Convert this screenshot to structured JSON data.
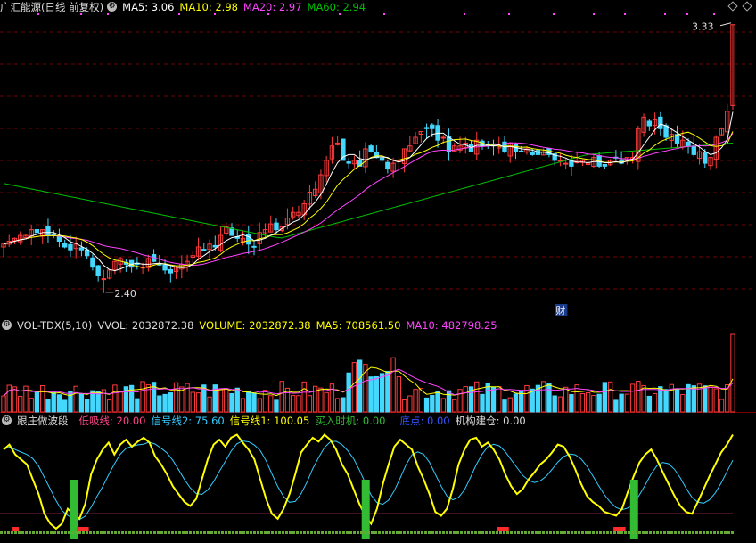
{
  "main_header": {
    "title": "广汇能源(日线 前复权)",
    "ma5": "MA5: 3.06",
    "ma10": "MA10: 2.98",
    "ma20": "MA20: 2.97",
    "ma60": "MA60: 2.94"
  },
  "vol_header": {
    "title": "VOL-TDX(5,10)",
    "vvol": "VVOL: 2032872.38",
    "volume": "VOLUME: 2032872.38",
    "ma5": "MA5: 708561.50",
    "ma10": "MA10: 482798.25"
  },
  "ind_header": {
    "title": "跟庄做波段",
    "low": "低吸线: 20.00",
    "sig2": "信号线2: 75.60",
    "sig1": "信号线1: 100.05",
    "buy": "买入时机: 0.00",
    "bottom": "底点: 0.00",
    "inst": "机构建仓: 0.00"
  },
  "annotations": {
    "high": "3.33",
    "low": "2.40",
    "fin_badge": "财"
  },
  "colors": {
    "up": "#ff3b3b",
    "down": "#44d8ff",
    "ma5": "#ffffff",
    "ma10": "#ffff00",
    "ma20": "#ff44ff",
    "ma60": "#00c000",
    "sig1": "#ffff00",
    "sig2": "#33ccff",
    "low_line": "#ff4488",
    "bar_green": "#33bb33",
    "grid": "#7a0000"
  },
  "chart_data": [
    {
      "type": "candlestick",
      "title": "广汇能源(日线 前复权)",
      "price_range": [
        2.35,
        3.36
      ],
      "series_names": [
        "MA5",
        "MA10",
        "MA20",
        "MA60"
      ],
      "close": [
        2.57,
        2.58,
        2.59,
        2.6,
        2.6,
        2.62,
        2.61,
        2.62,
        2.6,
        2.6,
        2.58,
        2.56,
        2.55,
        2.57,
        2.55,
        2.53,
        2.49,
        2.46,
        2.45,
        2.48,
        2.51,
        2.52,
        2.5,
        2.49,
        2.5,
        2.49,
        2.52,
        2.51,
        2.5,
        2.48,
        2.47,
        2.49,
        2.5,
        2.51,
        2.53,
        2.56,
        2.55,
        2.57,
        2.56,
        2.6,
        2.63,
        2.6,
        2.59,
        2.59,
        2.57,
        2.56,
        2.61,
        2.62,
        2.64,
        2.62,
        2.63,
        2.66,
        2.68,
        2.68,
        2.71,
        2.75,
        2.76,
        2.81,
        2.86,
        2.91,
        2.92,
        2.86,
        2.85,
        2.86,
        2.84,
        2.9,
        2.89,
        2.87,
        2.86,
        2.83,
        2.85,
        2.86,
        2.9,
        2.91,
        2.94,
        2.96,
        2.97,
        2.97,
        2.93,
        2.94,
        2.89,
        2.91,
        2.91,
        2.92,
        2.89,
        2.93,
        2.91,
        2.91,
        2.91,
        2.91,
        2.89,
        2.92,
        2.89,
        2.89,
        2.9,
        2.88,
        2.88,
        2.89,
        2.88,
        2.86,
        2.86,
        2.85,
        2.84,
        2.86,
        2.86,
        2.85,
        2.87,
        2.84,
        2.84,
        2.86,
        2.87,
        2.85,
        2.87,
        2.87,
        2.97,
        3.01,
        2.98,
        3.0,
        2.97,
        2.94,
        2.95,
        2.92,
        2.93,
        2.91,
        2.88,
        2.89,
        2.85,
        2.87,
        2.94,
        2.97,
        3.03,
        3.33
      ],
      "ma5_last": 3.06,
      "ma10_last": 2.98,
      "ma20_last": 2.97,
      "ma60_last": 2.94,
      "high_label": 3.33,
      "low_label": 2.4
    },
    {
      "type": "bar",
      "title": "VOL-TDX(5,10)",
      "series_names": [
        "VOLUME",
        "MA5",
        "MA10"
      ],
      "last_volume": 2032872.38,
      "ma5_last": 708561.5,
      "ma10_last": 482798.25
    },
    {
      "type": "line",
      "title": "跟庄做波段",
      "series_names": [
        "低吸线",
        "信号线2",
        "信号线1",
        "买入时机",
        "底点",
        "机构建仓"
      ],
      "low_line": 20.0,
      "sig2_last": 75.6,
      "sig1_last": 100.05,
      "sig1": [
        85,
        90,
        80,
        75,
        70,
        55,
        40,
        20,
        10,
        5,
        10,
        25,
        20,
        15,
        30,
        60,
        75,
        85,
        92,
        80,
        90,
        95,
        88,
        93,
        97,
        92,
        78,
        70,
        60,
        48,
        40,
        32,
        28,
        35,
        55,
        75,
        90,
        95,
        88,
        97,
        100,
        92,
        85,
        75,
        55,
        35,
        20,
        15,
        25,
        40,
        60,
        82,
        90,
        97,
        93,
        100,
        95,
        85,
        70,
        60,
        45,
        30,
        18,
        10,
        25,
        50,
        70,
        88,
        95,
        90,
        85,
        68,
        55,
        40,
        22,
        18,
        25,
        45,
        70,
        85,
        95,
        97,
        88,
        92,
        85,
        75,
        60,
        48,
        40,
        45,
        55,
        62,
        70,
        75,
        82,
        90,
        88,
        78,
        65,
        50,
        38,
        32,
        28,
        22,
        20,
        18,
        25,
        42,
        58,
        72,
        80,
        85,
        75,
        62,
        50,
        38,
        28,
        22,
        20,
        32,
        45,
        58,
        70,
        82,
        90,
        100
      ],
      "buy_signal_bars": [
        12,
        62,
        108
      ]
    }
  ]
}
